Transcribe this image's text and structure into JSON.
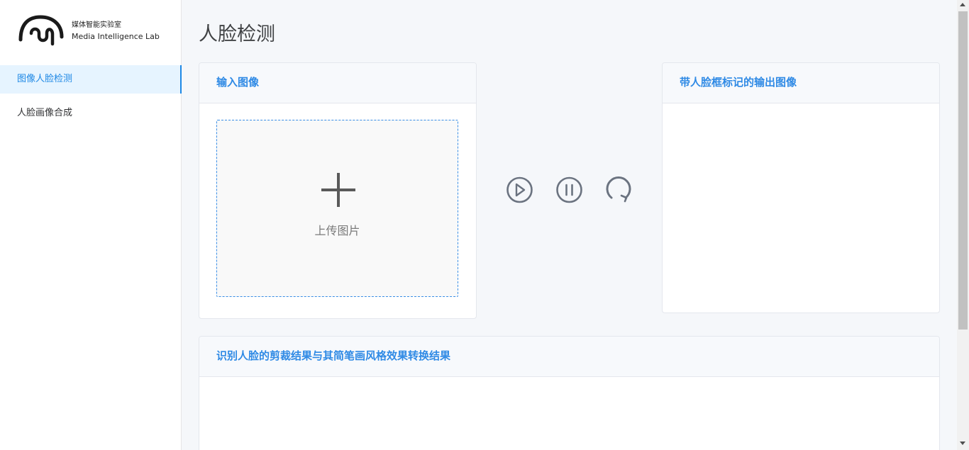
{
  "brand": {
    "name_cn": "媒体智能实验室",
    "name_en": "Media Intelligence Lab"
  },
  "sidebar": {
    "items": [
      {
        "label": "图像人脸检测",
        "active": true
      },
      {
        "label": "人脸画像合成",
        "active": false
      }
    ]
  },
  "page": {
    "title": "人脸检测"
  },
  "input_card": {
    "title": "输入图像",
    "upload_label": "上传图片",
    "upload_icon": "plus-icon"
  },
  "controls": {
    "icons": [
      "play-icon",
      "pause-icon",
      "refresh-icon"
    ]
  },
  "output_card": {
    "title": "带人脸框标记的输出图像"
  },
  "result_card": {
    "title": "识别人脸的剪裁结果与其简笔画风格效果转换结果"
  },
  "colors": {
    "accent": "#1e88e5",
    "heading_blue": "#2f8ae5",
    "active_bg": "#e6f4ff",
    "page_bg": "#f5f7fa"
  }
}
